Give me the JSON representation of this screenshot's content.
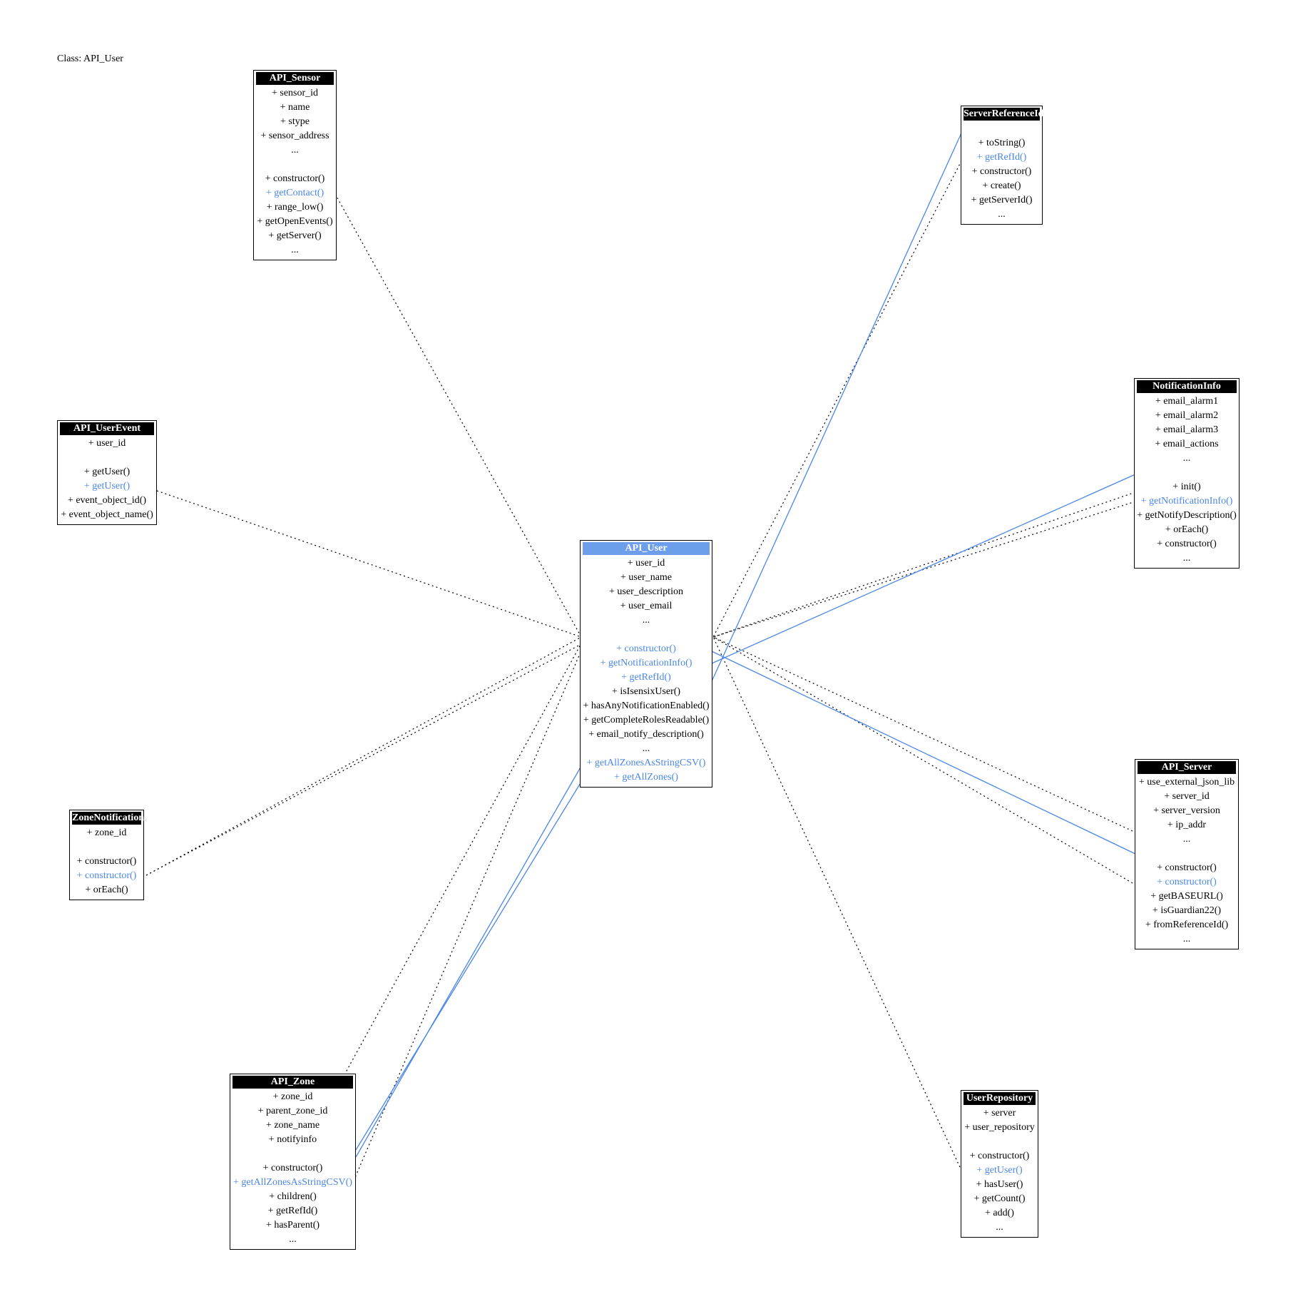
{
  "title": "Class: API_User",
  "colors": {
    "highlight": "#4a86e8",
    "focus_header": "#6d9eeb",
    "header": "#000000",
    "edge": "#000000"
  },
  "classes": {
    "api_sensor": {
      "name": "API_Sensor",
      "fields": [
        {
          "text": "+ sensor_id",
          "hl": false
        },
        {
          "text": "+ name",
          "hl": false
        },
        {
          "text": "+ stype",
          "hl": false
        },
        {
          "text": "+ sensor_address",
          "hl": false
        },
        {
          "text": "...",
          "hl": false
        }
      ],
      "methods": [
        {
          "text": "+ constructor()",
          "hl": false
        },
        {
          "text": "+ getContact()",
          "hl": true
        },
        {
          "text": "+ range_low()",
          "hl": false
        },
        {
          "text": "+ getOpenEvents()",
          "hl": false
        },
        {
          "text": "+ getServer()",
          "hl": false
        },
        {
          "text": "...",
          "hl": false
        }
      ]
    },
    "server_reference_id": {
      "name": "ServerReferenceId",
      "fields": [],
      "methods": [
        {
          "text": "+ toString()",
          "hl": false
        },
        {
          "text": "+ getRefId()",
          "hl": true
        },
        {
          "text": "+ constructor()",
          "hl": false
        },
        {
          "text": "+ create()",
          "hl": false
        },
        {
          "text": "+ getServerId()",
          "hl": false
        },
        {
          "text": "...",
          "hl": false
        }
      ]
    },
    "api_user_event": {
      "name": "API_UserEvent",
      "fields": [
        {
          "text": "+ user_id",
          "hl": false
        }
      ],
      "methods": [
        {
          "text": "+ getUser()",
          "hl": false
        },
        {
          "text": "+ getUser()",
          "hl": true
        },
        {
          "text": "+ event_object_id()",
          "hl": false
        },
        {
          "text": "+ event_object_name()",
          "hl": false
        }
      ]
    },
    "notification_info": {
      "name": "NotificationInfo",
      "fields": [
        {
          "text": "+ email_alarm1",
          "hl": false
        },
        {
          "text": "+ email_alarm2",
          "hl": false
        },
        {
          "text": "+ email_alarm3",
          "hl": false
        },
        {
          "text": "+ email_actions",
          "hl": false
        },
        {
          "text": "...",
          "hl": false
        }
      ],
      "methods": [
        {
          "text": "+ init()",
          "hl": false
        },
        {
          "text": "+ getNotificationInfo()",
          "hl": true
        },
        {
          "text": "+ getNotifyDescription()",
          "hl": false
        },
        {
          "text": "+ orEach()",
          "hl": false
        },
        {
          "text": "+ constructor()",
          "hl": false
        },
        {
          "text": "...",
          "hl": false
        }
      ]
    },
    "api_user": {
      "name": "API_User",
      "fields": [
        {
          "text": "+ user_id",
          "hl": false
        },
        {
          "text": "+ user_name",
          "hl": false
        },
        {
          "text": "+ user_description",
          "hl": false
        },
        {
          "text": "+ user_email",
          "hl": false
        },
        {
          "text": "...",
          "hl": false
        }
      ],
      "methods": [
        {
          "text": "+ constructor()",
          "hl": true
        },
        {
          "text": "+ getNotificationInfo()",
          "hl": true
        },
        {
          "text": "+ getRefId()",
          "hl": true
        },
        {
          "text": "+ isIsensixUser()",
          "hl": false
        },
        {
          "text": "+ hasAnyNotificationEnabled()",
          "hl": false
        },
        {
          "text": "+ getCompleteRolesReadable()",
          "hl": false
        },
        {
          "text": "+ email_notify_description()",
          "hl": false
        },
        {
          "text": "...",
          "hl": false
        },
        {
          "text": "+ getAllZonesAsStringCSV()",
          "hl": true
        },
        {
          "text": "+ getAllZones()",
          "hl": true
        }
      ]
    },
    "zone_notification": {
      "name": "ZoneNotification",
      "fields": [
        {
          "text": "+ zone_id",
          "hl": false
        }
      ],
      "methods": [
        {
          "text": "+ constructor()",
          "hl": false
        },
        {
          "text": "+ constructor()",
          "hl": true
        },
        {
          "text": "+ orEach()",
          "hl": false
        }
      ]
    },
    "api_server": {
      "name": "API_Server",
      "fields": [
        {
          "text": "+ use_external_json_lib",
          "hl": false
        },
        {
          "text": "+ server_id",
          "hl": false
        },
        {
          "text": "+ server_version",
          "hl": false
        },
        {
          "text": "+ ip_addr",
          "hl": false
        },
        {
          "text": "...",
          "hl": false
        }
      ],
      "methods": [
        {
          "text": "+ constructor()",
          "hl": false
        },
        {
          "text": "+ constructor()",
          "hl": true
        },
        {
          "text": "+ getBASEURL()",
          "hl": false
        },
        {
          "text": "+ isGuardian22()",
          "hl": false
        },
        {
          "text": "+ fromReferenceId()",
          "hl": false
        },
        {
          "text": "...",
          "hl": false
        }
      ]
    },
    "api_zone": {
      "name": "API_Zone",
      "fields": [
        {
          "text": "+ zone_id",
          "hl": false
        },
        {
          "text": "+ parent_zone_id",
          "hl": false
        },
        {
          "text": "+ zone_name",
          "hl": false
        },
        {
          "text": "+ notifyinfo",
          "hl": false
        }
      ],
      "methods": [
        {
          "text": "+ constructor()",
          "hl": false
        },
        {
          "text": "+ getAllZonesAsStringCSV()",
          "hl": true
        },
        {
          "text": "+ children()",
          "hl": false
        },
        {
          "text": "+ getRefId()",
          "hl": false
        },
        {
          "text": "+ hasParent()",
          "hl": false
        },
        {
          "text": "...",
          "hl": false
        }
      ]
    },
    "user_repository": {
      "name": "UserRepository",
      "fields": [
        {
          "text": "+ server",
          "hl": false
        },
        {
          "text": "+ user_repository",
          "hl": false
        }
      ],
      "methods": [
        {
          "text": "+ constructor()",
          "hl": false
        },
        {
          "text": "+ getUser()",
          "hl": true
        },
        {
          "text": "+ hasUser()",
          "hl": false
        },
        {
          "text": "+ getCount()",
          "hl": false
        },
        {
          "text": "+ add()",
          "hl": false
        },
        {
          "text": "...",
          "hl": false
        }
      ]
    }
  }
}
